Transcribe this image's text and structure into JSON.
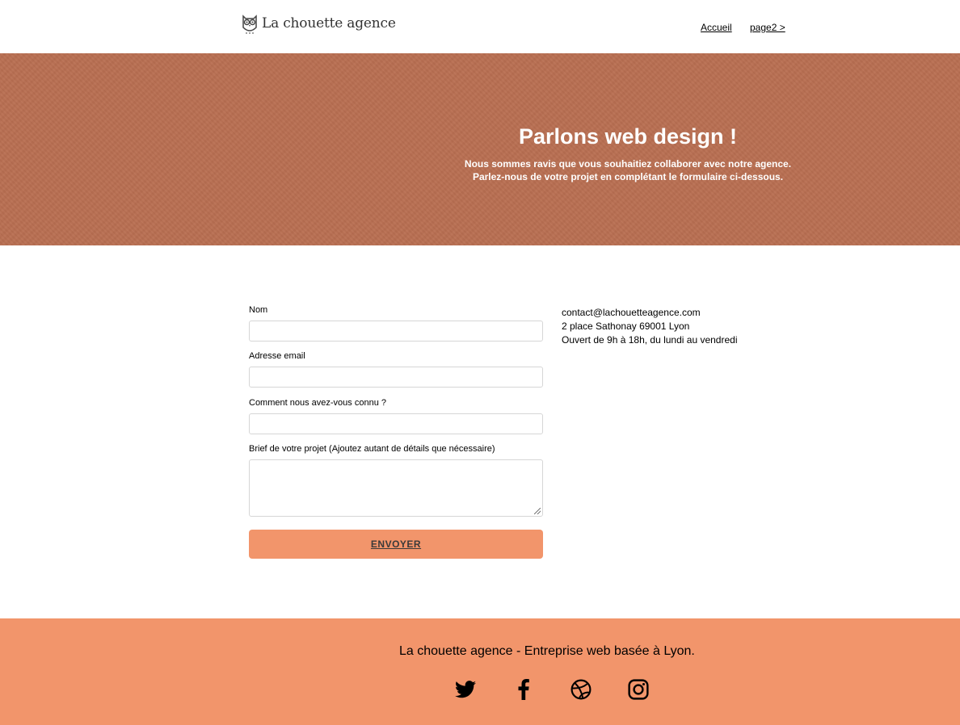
{
  "header": {
    "brand": "La chouette agence",
    "logo_icon": "owl-icon",
    "nav": [
      {
        "label": "Accueil"
      },
      {
        "label": "page2 >"
      }
    ]
  },
  "hero": {
    "title": "Parlons web design !",
    "line1": "Nous sommes ravis que vous souhaitiez collaborer avec notre agence.",
    "line2": "Parlez-nous de votre projet en complétant le formulaire ci-dessous."
  },
  "form": {
    "name_label": "Nom",
    "name_value": "",
    "email_label": "Adresse email",
    "email_value": "",
    "source_label": "Comment nous avez-vous connu ?",
    "source_value": "",
    "brief_label": "Brief de votre projet (Ajoutez autant de détails que nécessaire)",
    "brief_value": "",
    "submit_label": "ENVOYER"
  },
  "contact": {
    "email": "contact@lachouetteagence.com",
    "address": "2 place Sathonay 69001 Lyon",
    "hours": "Ouvert de 9h à 18h, du lundi au vendredi"
  },
  "footer": {
    "tagline": "La chouette agence - Entreprise web basée à Lyon.",
    "social": [
      "twitter-icon",
      "facebook-icon",
      "dribbble-icon",
      "instagram-icon"
    ]
  },
  "colors": {
    "hero_bg": "#b96f52",
    "accent": "#f2956b"
  }
}
